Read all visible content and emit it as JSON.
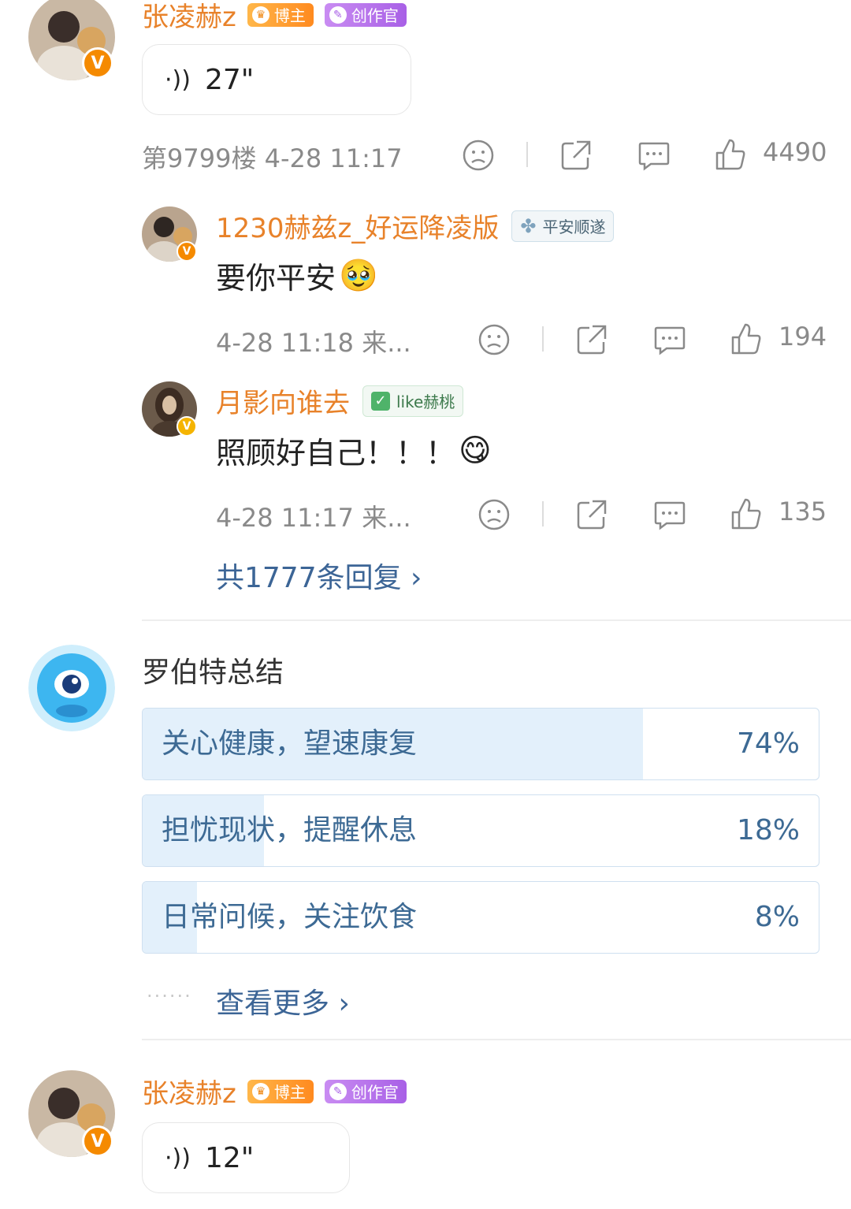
{
  "comment1": {
    "username": "张凌赫z",
    "tag_boz": "博主",
    "tag_creator": "创作官",
    "voice_duration": "27\"",
    "floor_time": "第9799楼 4-28 11:17",
    "likes": "4490"
  },
  "replies": [
    {
      "username": "1230赫兹z_好运降凌版",
      "badge_text": "平安顺遂",
      "badge_icon": "clover-icon",
      "text": "要你平安",
      "emoji": "🥹",
      "meta": "4-28 11:18 来...",
      "likes": "194"
    },
    {
      "username": "月影向谁去",
      "badge_text": "like赫桃",
      "badge_icon": "checkmark-icon",
      "text": "照顾好自己！！！",
      "emoji": "😋",
      "meta": "4-28 11:17 来...",
      "likes": "135"
    }
  ],
  "reply_count_link": "共1777条回复 ›",
  "summary": {
    "title": "罗伯特总结",
    "options": [
      {
        "label": "关心健康，望速康复",
        "percent": "74%",
        "value": 0.74
      },
      {
        "label": "担忧现状，提醒休息",
        "percent": "18%",
        "value": 0.18
      },
      {
        "label": "日常问候，关注饮食",
        "percent": "8%",
        "value": 0.08
      }
    ],
    "more_link": "查看更多 ›"
  },
  "comment2": {
    "username": "张凌赫z",
    "tag_boz": "博主",
    "tag_creator": "创作官",
    "voice_duration": "12\""
  },
  "colors": {
    "name": "#e8822a",
    "link": "#3c6596",
    "poll_fill": "#e3f0fb",
    "poll_text": "#3d6a94",
    "verified": "#f58a00"
  }
}
